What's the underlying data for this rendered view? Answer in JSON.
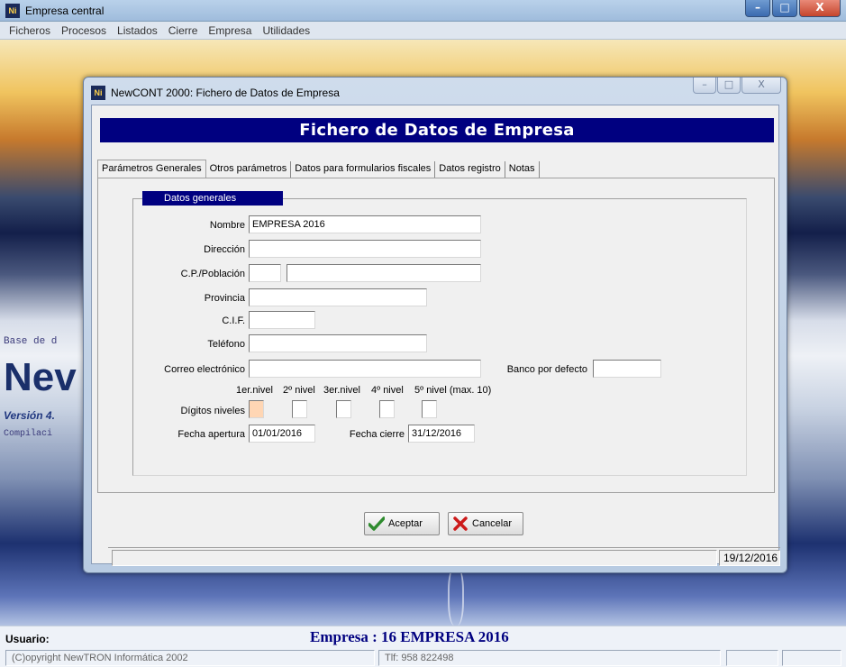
{
  "outer_window": {
    "icon_text": "Ni",
    "title": "Empresa central",
    "controls": {
      "minimize": "–",
      "maximize": "□",
      "close": "X"
    }
  },
  "menu": [
    "Ficheros",
    "Procesos",
    "Listados",
    "Cierre",
    "Empresa",
    "Utilidades"
  ],
  "background": {
    "base_text": "Base de d",
    "logo_text": "Nev",
    "version_text": "Versión 4.",
    "compile_text": "Compilaci"
  },
  "dialog": {
    "icon_text": "Ni",
    "title": "NewCONT 2000: Fichero de Datos de Empresa",
    "controls": {
      "minimize": "–",
      "maximize": "□",
      "close": "X"
    },
    "header": "Fichero de Datos de Empresa",
    "tabs": [
      "Parámetros Generales",
      "Otros parámetros",
      "Datos para formularios fiscales",
      "Datos registro",
      "Notas"
    ],
    "active_tab": "Parámetros Generales",
    "group_title": "Datos generales",
    "fields": {
      "nombre": {
        "label": "Nombre",
        "value": "EMPRESA 2016"
      },
      "direccion": {
        "label": "Dirección",
        "value": ""
      },
      "cp_poblacion": {
        "label": "C.P./Población",
        "cp": "",
        "poblacion": ""
      },
      "provincia": {
        "label": "Provincia",
        "value": ""
      },
      "cif": {
        "label": "C.I.F.",
        "value": ""
      },
      "telefono": {
        "label": "Teléfono",
        "value": ""
      },
      "correo": {
        "label": "Correo electrónico",
        "value": ""
      },
      "banco": {
        "label": "Banco por defecto",
        "value": ""
      },
      "digitos": {
        "label": "Dígitos niveles",
        "headers": [
          "1er.nivel",
          "2º nivel",
          "3er.nivel",
          "4º nivel",
          "5º nivel (max. 10)"
        ],
        "values": [
          "",
          "",
          "",
          "",
          ""
        ]
      },
      "fecha_apertura": {
        "label": "Fecha apertura",
        "value": "01/01/2016"
      },
      "fecha_cierre": {
        "label": "Fecha cierre",
        "value": "31/12/2016"
      }
    },
    "buttons": {
      "accept": "Aceptar",
      "cancel": "Cancelar"
    },
    "status": {
      "left": "",
      "date": "19/12/2016"
    }
  },
  "bottom": {
    "usuario_label": "Usuario:",
    "empresa": "Empresa : 16 EMPRESA 2016",
    "copyright": "(C)opyright NewTRON Informática 2002",
    "phone": "Tlf: 958 822498"
  },
  "colors": {
    "banner": "#000080",
    "accept_icon": "#2e8b2e",
    "cancel_icon": "#cc1a1a",
    "focused_field": "#ffd6b4"
  }
}
